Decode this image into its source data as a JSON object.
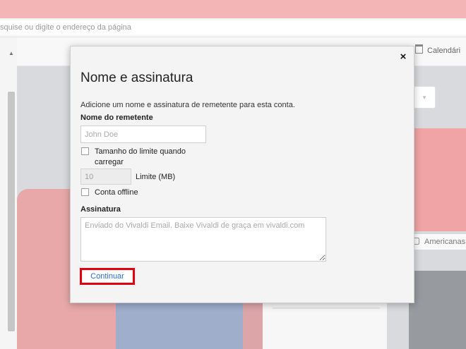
{
  "browser": {
    "address_placeholder": "squise ou digite o endereço da página",
    "calendar_label": "Calendári",
    "bookmark_label": "Americanas.c",
    "dropdown_arrow": "▾",
    "scroll_up": "▲"
  },
  "dialog": {
    "close_label": "×",
    "title": "Nome e assinatura",
    "description": "Adicione um nome e assinatura de remetente para esta conta.",
    "sender_label": "Nome do remetente",
    "sender_placeholder": "John Doe",
    "size_limit_label": "Tamanho do limite quando carregar",
    "limit_placeholder": "10",
    "limit_unit_label": "Limite (MB)",
    "offline_label": "Conta offline",
    "signature_label": "Assinatura",
    "signature_placeholder": "Enviado do Vivaldi Email. Baixe Vivaldi de graça em vivaldi.com",
    "continue_label": "Continuar"
  },
  "colors": {
    "highlight": "#e0000f",
    "link_blue": "#2b6acb",
    "titlebar_pink": "#f3b5b5"
  }
}
